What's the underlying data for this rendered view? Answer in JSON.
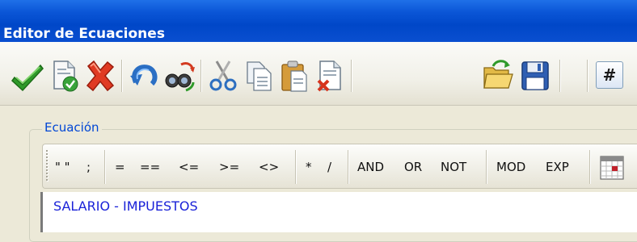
{
  "window": {
    "title": "Editor de Ecuaciones"
  },
  "toolbar": {
    "buttons": [
      {
        "name": "accept-check-icon"
      },
      {
        "name": "validate-document-icon"
      },
      {
        "name": "cancel-x-icon"
      },
      {
        "name": "undo-icon"
      },
      {
        "name": "search-replace-binoculars-icon"
      },
      {
        "name": "cut-scissors-icon"
      },
      {
        "name": "copy-icon"
      },
      {
        "name": "paste-icon"
      },
      {
        "name": "delete-document-icon"
      },
      {
        "name": "open-folder-icon"
      },
      {
        "name": "save-floppy-icon"
      }
    ],
    "hash_label": "#"
  },
  "equation_group": {
    "legend": "Ecuación",
    "operators": {
      "quotes": "\" \"",
      "semicolon": ";",
      "equals": "=",
      "double_equals": "==",
      "less_equal": "<=",
      "greater_equal": ">=",
      "not_equal": "<>",
      "multiply": "*",
      "divide": "/",
      "and": "AND",
      "or": "OR",
      "not": "NOT",
      "mod": "MOD",
      "exp": "EXP"
    },
    "formula_text": "SALARIO - IMPUESTOS"
  },
  "colors": {
    "titlebar": "#0a55d6",
    "legend_text": "#0046d5",
    "formula_text": "#1a22d8"
  }
}
